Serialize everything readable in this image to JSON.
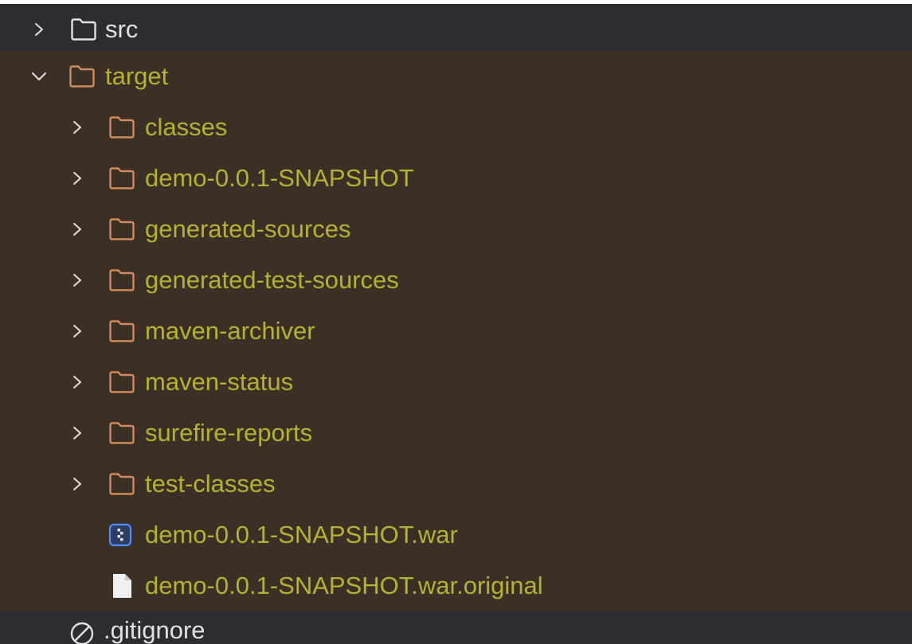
{
  "colors": {
    "panel_background": "#2b2d30",
    "excluded_background": "#3a3025",
    "excluded_text": "#b4b230",
    "normal_text": "#dfe1e5",
    "excluded_folder_icon": "#d08a61",
    "normal_folder_icon": "#dfe1e5",
    "war_icon": "#548af7"
  },
  "tree": {
    "items": [
      {
        "label": "src",
        "icon": "folder-icon",
        "expander": "chevron-right-icon",
        "excluded": false
      },
      {
        "label": "target",
        "icon": "folder-icon",
        "expander": "chevron-down-icon",
        "excluded": true,
        "expanded": true
      },
      {
        "label": "classes",
        "icon": "folder-icon",
        "expander": "chevron-right-icon",
        "excluded": true
      },
      {
        "label": "demo-0.0.1-SNAPSHOT",
        "icon": "folder-icon",
        "expander": "chevron-right-icon",
        "excluded": true
      },
      {
        "label": "generated-sources",
        "icon": "folder-icon",
        "expander": "chevron-right-icon",
        "excluded": true
      },
      {
        "label": "generated-test-sources",
        "icon": "folder-icon",
        "expander": "chevron-right-icon",
        "excluded": true
      },
      {
        "label": "maven-archiver",
        "icon": "folder-icon",
        "expander": "chevron-right-icon",
        "excluded": true
      },
      {
        "label": "maven-status",
        "icon": "folder-icon",
        "expander": "chevron-right-icon",
        "excluded": true
      },
      {
        "label": "surefire-reports",
        "icon": "folder-icon",
        "expander": "chevron-right-icon",
        "excluded": true
      },
      {
        "label": "test-classes",
        "icon": "folder-icon",
        "expander": "chevron-right-icon",
        "excluded": true
      },
      {
        "label": "demo-0.0.1-SNAPSHOT.war",
        "icon": "war-archive-icon",
        "excluded": true
      },
      {
        "label": "demo-0.0.1-SNAPSHOT.war.original",
        "icon": "file-icon",
        "excluded": true
      },
      {
        "label": ".gitignore",
        "icon": "ignored-file-icon",
        "excluded": false
      }
    ]
  }
}
